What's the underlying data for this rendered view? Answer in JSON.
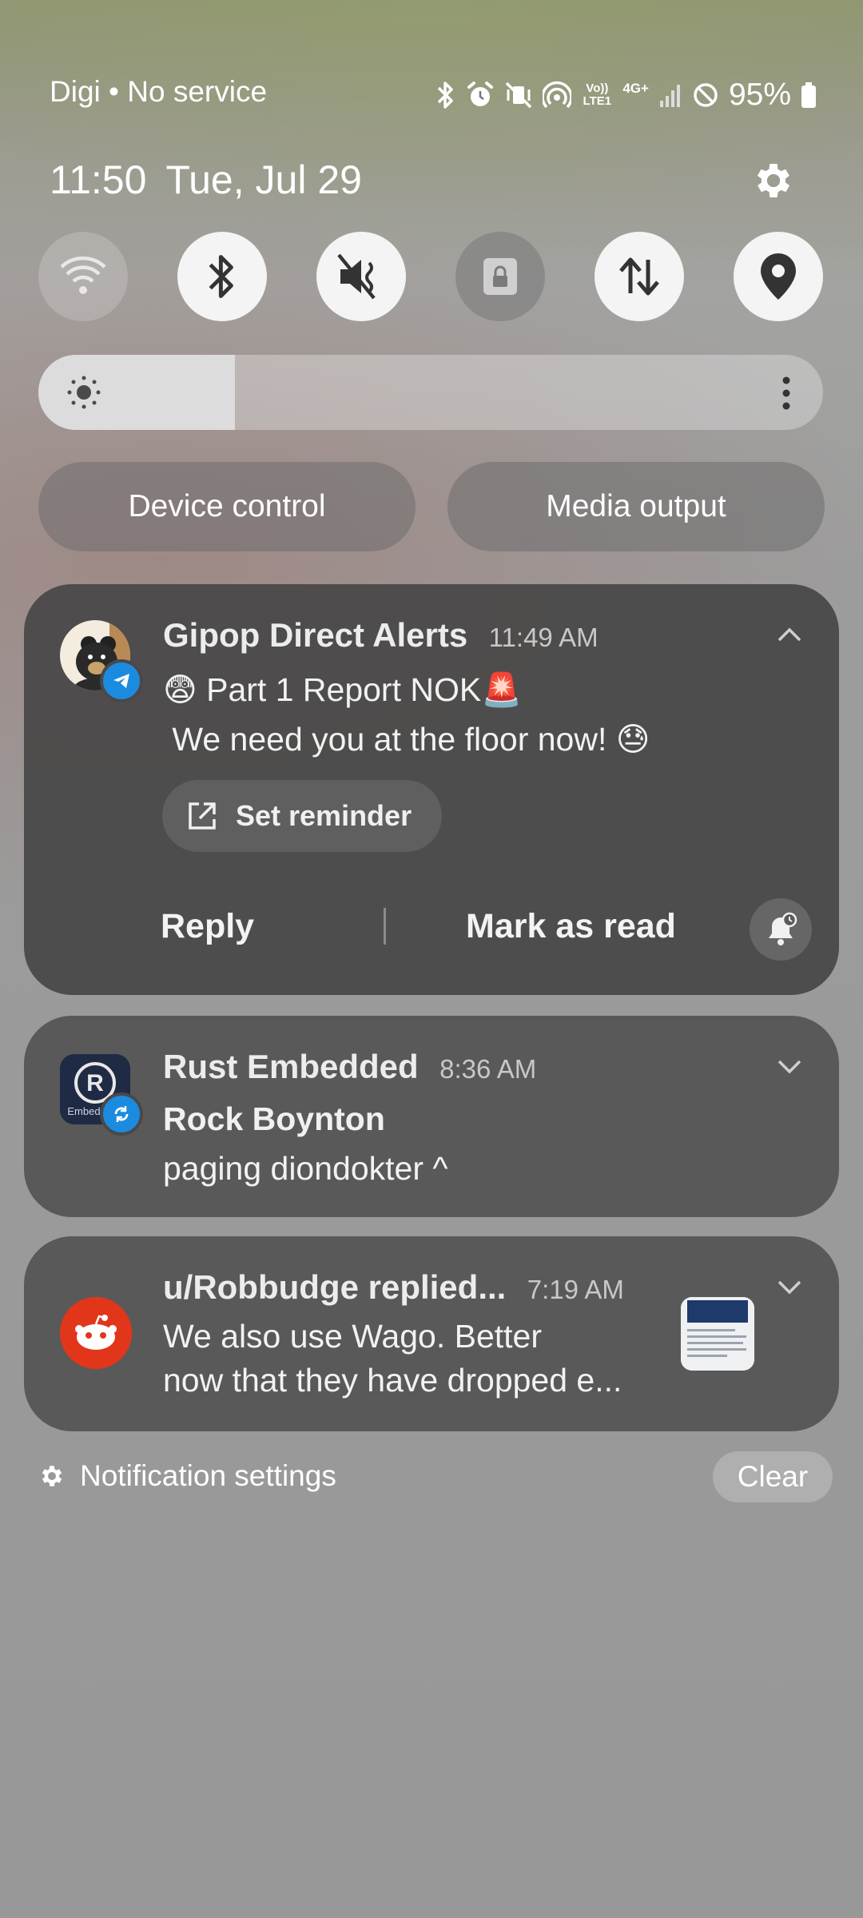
{
  "status_bar": {
    "carrier": "Digi • No service",
    "battery": "95%",
    "net_volte": "Vo)) LTE1",
    "net_4g": "4G+",
    "icons": [
      "bluetooth-icon",
      "alarm-icon",
      "vibrate-mute-icon",
      "hotspot-icon",
      "volte-icon",
      "4g-plus-icon",
      "signal-icon",
      "no-service-icon",
      "battery-icon"
    ]
  },
  "header": {
    "time": "11:50",
    "date": "Tue, Jul 29"
  },
  "quick_toggles": [
    {
      "name": "wifi",
      "state": "off"
    },
    {
      "name": "bluetooth",
      "state": "on"
    },
    {
      "name": "mute",
      "state": "on"
    },
    {
      "name": "rotation-lock",
      "state": "dim"
    },
    {
      "name": "mobile-data",
      "state": "on"
    },
    {
      "name": "location",
      "state": "on"
    }
  ],
  "brightness": {
    "level": 0.25
  },
  "buttons": {
    "device_control": "Device control",
    "media_output": "Media output"
  },
  "notifications": [
    {
      "app": "Gipop Direct Alerts",
      "time": "11:49 AM",
      "line1": "😨 Part 1 Report NOK🚨",
      "line2": " We need you at the floor now! 😓",
      "reminder_label": "Set reminder",
      "reply_label": "Reply",
      "mark_read_label": "Mark as read",
      "badge": "telegram-icon"
    },
    {
      "app": "Rust Embedded",
      "time": "8:36 AM",
      "sender": "Rock Boynton",
      "message": "paging diondokter ^",
      "badge": "sync-icon"
    },
    {
      "app": "u/Robbudge replied...",
      "time": "7:19 AM",
      "line1": "We also use Wago. Better",
      "line2": "now that they have dropped e...",
      "icon": "reddit-icon"
    }
  ],
  "footer": {
    "settings_label": "Notification settings",
    "clear_label": "Clear"
  }
}
